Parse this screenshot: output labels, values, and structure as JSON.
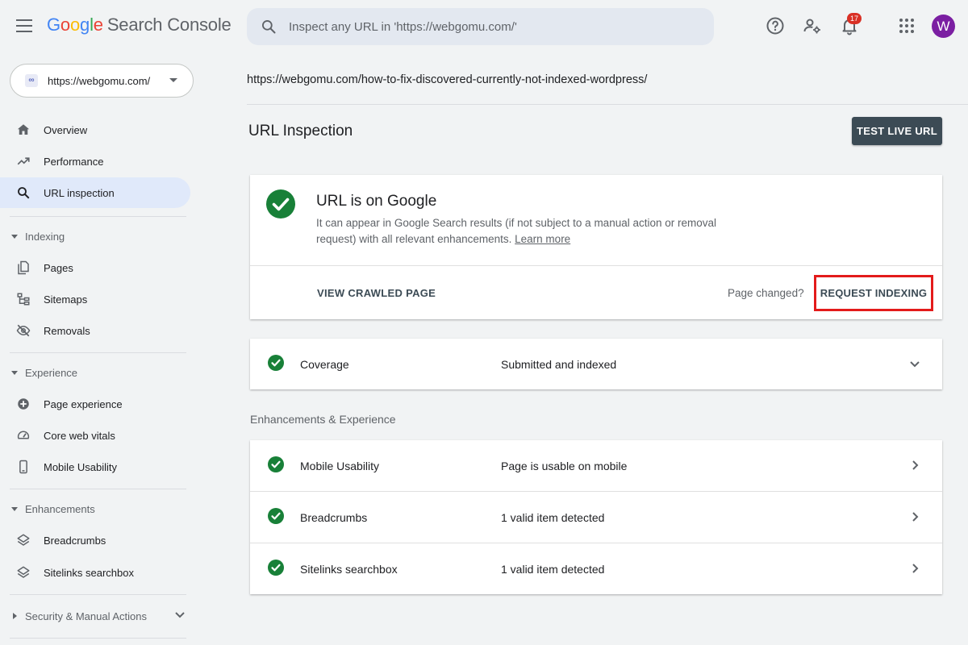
{
  "header": {
    "logo_google": [
      "G",
      "o",
      "o",
      "g",
      "l",
      "e"
    ],
    "logo_product": "Search Console",
    "search_placeholder": "Inspect any URL in 'https://webgomu.com/'",
    "notification_count": "17",
    "avatar_letter": "W"
  },
  "sidebar": {
    "property": {
      "icon_text": "∞",
      "label": "https://webgomu.com/"
    },
    "top_items": [
      {
        "label": "Overview",
        "icon": "home-icon"
      },
      {
        "label": "Performance",
        "icon": "trending-up-icon"
      },
      {
        "label": "URL inspection",
        "icon": "search-icon",
        "active": true
      }
    ],
    "sections": {
      "indexing": {
        "label": "Indexing",
        "items": [
          "Pages",
          "Sitemaps",
          "Removals"
        ]
      },
      "experience": {
        "label": "Experience",
        "items": [
          "Page experience",
          "Core web vitals",
          "Mobile Usability"
        ]
      },
      "enhancements": {
        "label": "Enhancements",
        "items": [
          "Breadcrumbs",
          "Sitelinks searchbox"
        ]
      },
      "security": {
        "label": "Security & Manual Actions"
      }
    }
  },
  "main": {
    "inspected_url": "https://webgomu.com/how-to-fix-discovered-currently-not-indexed-wordpress/",
    "page_title": "URL Inspection",
    "test_live_url": "TEST LIVE URL",
    "status_card": {
      "title": "URL is on Google",
      "description": "It can appear in Google Search results (if not subject to a manual action or removal request) with all relevant enhancements.",
      "learn_more": "Learn more",
      "view_crawled": "VIEW CRAWLED PAGE",
      "page_changed": "Page changed?",
      "request_indexing": "REQUEST INDEXING"
    },
    "coverage": {
      "label": "Coverage",
      "value": "Submitted and indexed"
    },
    "enhancements_heading": "Enhancements & Experience",
    "enhancement_rows": [
      {
        "label": "Mobile Usability",
        "value": "Page is usable on mobile"
      },
      {
        "label": "Breadcrumbs",
        "value": "1 valid item detected"
      },
      {
        "label": "Sitelinks searchbox",
        "value": "1 valid item detected"
      }
    ]
  },
  "colors": {
    "check_green": "#188038",
    "highlight_red": "#e31b1b",
    "button_dark": "#3c4b55",
    "active_nav": "#e0e9fa",
    "avatar": "#7b1fa2"
  }
}
